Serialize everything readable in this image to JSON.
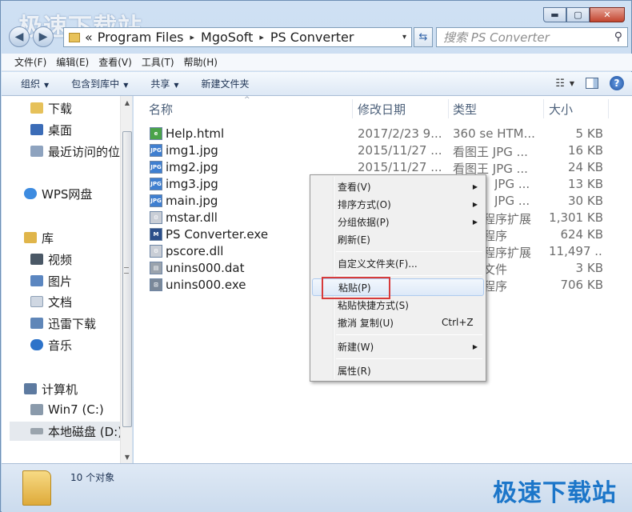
{
  "watermark": {
    "top": "极速下载站",
    "bottom": "极速下载站"
  },
  "window": {
    "controls": {
      "minimize": "▬",
      "maximize": "▢",
      "close": "✕"
    }
  },
  "address": {
    "prefix": "«",
    "path": [
      "Program Files",
      "MgoSoft",
      "PS Converter"
    ],
    "separator": "▸",
    "dropdown": "▾",
    "refresh": "⇆"
  },
  "search": {
    "placeholder": "搜索 PS Converter",
    "icon": "⚲"
  },
  "menubar": [
    "文件(F)",
    "编辑(E)",
    "查看(V)",
    "工具(T)",
    "帮助(H)"
  ],
  "toolbar": {
    "organize": "组织",
    "include": "包含到库中",
    "share": "共享",
    "new_folder": "新建文件夹",
    "caret": "▼",
    "view_icon": "☷",
    "view_caret": "▼",
    "help": "?"
  },
  "nav": {
    "items": [
      {
        "label": "下载",
        "icon": "download-folder-icon",
        "color": "#e6c15a"
      },
      {
        "label": "桌面",
        "icon": "desktop-icon",
        "color": "#3b6cb7"
      },
      {
        "label": "最近访问的位置",
        "icon": "recent-places-icon",
        "color": "#8ea3bf"
      },
      {
        "label": "WPS网盘",
        "icon": "cloud-icon",
        "color": "#3d8be0"
      },
      {
        "label": "库",
        "icon": "library-icon",
        "color": "#e0b54a"
      },
      {
        "label": "视频",
        "icon": "video-icon",
        "color": "#4a5866"
      },
      {
        "label": "图片",
        "icon": "picture-icon",
        "color": "#5b86c0"
      },
      {
        "label": "文档",
        "icon": "document-icon",
        "color": "#cfd7e2"
      },
      {
        "label": "迅雷下载",
        "icon": "thunder-folder-icon",
        "color": "#5f86b8"
      },
      {
        "label": "音乐",
        "icon": "music-icon",
        "color": "#2d73c9"
      },
      {
        "label": "计算机",
        "icon": "computer-icon",
        "color": "#5d7aa0"
      },
      {
        "label": "Win7 (C:)",
        "icon": "drive-c-icon",
        "color": "#8a9aab"
      },
      {
        "label": "本地磁盘 (D:)",
        "icon": "drive-d-icon",
        "color": "#9aa4ad"
      }
    ],
    "scroll_up": "▲",
    "scroll_down": "▼"
  },
  "columns": {
    "name": "名称",
    "date": "修改日期",
    "type": "类型",
    "size": "大小",
    "sort_indicator": "^"
  },
  "files": [
    {
      "name": "Help.html",
      "date": "2017/2/23 9...",
      "type": "360 se HTM...",
      "size": "5 KB",
      "icon": "html-file-icon",
      "icon_color": "#4aa34a",
      "icon_text": "e"
    },
    {
      "name": "img1.jpg",
      "date": "2015/11/27 ...",
      "type": "看图王 JPG ...",
      "size": "16 KB",
      "icon": "jpg-file-icon",
      "icon_color": "#3f7fd0",
      "icon_text": "JPG"
    },
    {
      "name": "img2.jpg",
      "date": "2015/11/27 ...",
      "type": "看图王 JPG ...",
      "size": "24 KB",
      "icon": "jpg-file-icon",
      "icon_color": "#3f7fd0",
      "icon_text": "JPG"
    },
    {
      "name": "img3.jpg",
      "date": "",
      "type": "JPG ...",
      "size": "13 KB",
      "icon": "jpg-file-icon",
      "icon_color": "#3f7fd0",
      "icon_text": "JPG"
    },
    {
      "name": "main.jpg",
      "date": "",
      "type": "JPG ...",
      "size": "30 KB",
      "icon": "jpg-file-icon",
      "icon_color": "#3f7fd0",
      "icon_text": "JPG"
    },
    {
      "name": "mstar.dll",
      "date": "",
      "type": "程序扩展",
      "size": "1,301 KB",
      "icon": "dll-file-icon",
      "icon_color": "#c9ced6",
      "icon_text": "⚙"
    },
    {
      "name": "PS Converter.exe",
      "date": "",
      "type": "程序",
      "size": "624 KB",
      "icon": "app-exe-icon",
      "icon_color": "#2c4f8a",
      "icon_text": "M"
    },
    {
      "name": "pscore.dll",
      "date": "",
      "type": "程序扩展",
      "size": "11,497 ...",
      "icon": "dll-file-icon",
      "icon_color": "#c9ced6",
      "icon_text": "⚙"
    },
    {
      "name": "unins000.dat",
      "date": "",
      "type": "文件",
      "size": "3 KB",
      "icon": "dat-file-icon",
      "icon_color": "#9aa3ad",
      "icon_text": "▤"
    },
    {
      "name": "unins000.exe",
      "date": "",
      "type": "程序",
      "size": "706 KB",
      "icon": "uninstall-exe-icon",
      "icon_color": "#7a8899",
      "icon_text": "⊡"
    }
  ],
  "status": {
    "count": "10 个对象"
  },
  "context_menu": {
    "items": [
      {
        "label": "查看(V)",
        "submenu": true
      },
      {
        "label": "排序方式(O)",
        "submenu": true
      },
      {
        "label": "分组依据(P)",
        "submenu": true
      },
      {
        "label": "刷新(E)"
      },
      {
        "separator": true
      },
      {
        "label": "自定义文件夹(F)..."
      },
      {
        "separator": true
      },
      {
        "label": "粘贴(P)",
        "highlighted": true
      },
      {
        "label": "粘贴快捷方式(S)"
      },
      {
        "label": "撤消 复制(U)",
        "shortcut": "Ctrl+Z"
      },
      {
        "separator": true
      },
      {
        "label": "新建(W)",
        "submenu": true
      },
      {
        "separator": true
      },
      {
        "label": "属性(R)"
      }
    ],
    "submenu_arrow": "▶"
  },
  "highlight_color": "#d73b3b"
}
